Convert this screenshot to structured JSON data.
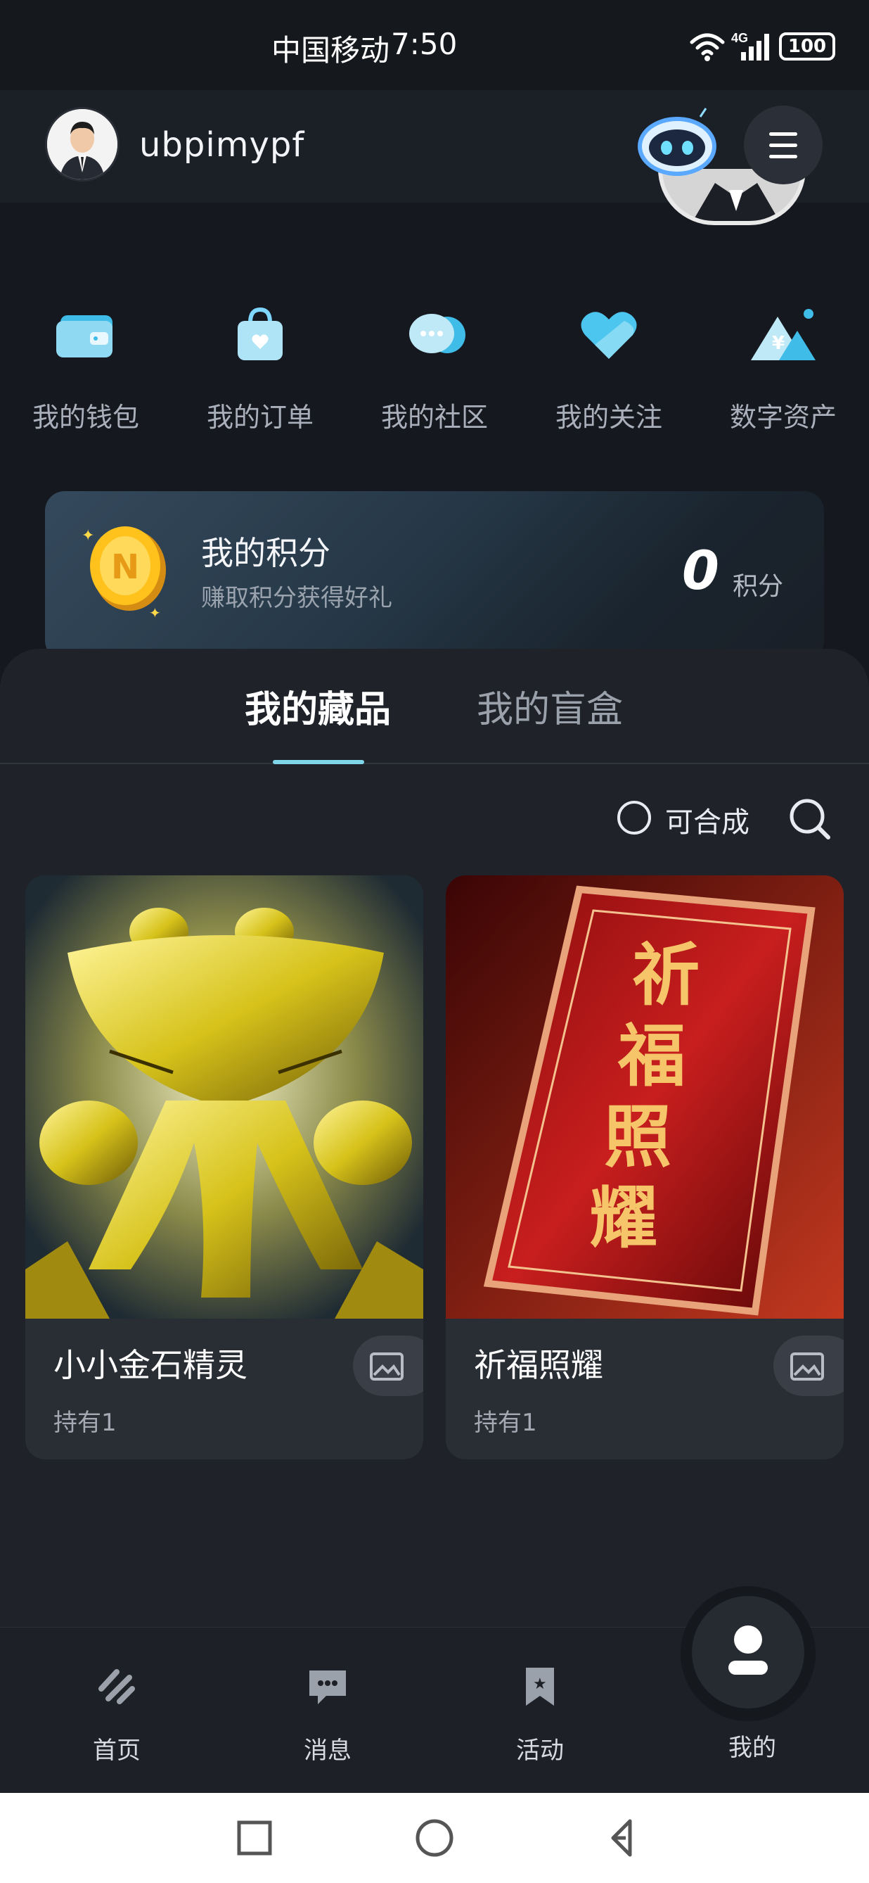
{
  "status_bar": {
    "carrier": "中国移动",
    "time": "7:50",
    "network": "4G",
    "battery": "100"
  },
  "header": {
    "username": "ubpimypf"
  },
  "quick_nav": [
    {
      "label": "我的钱包",
      "icon": "wallet-icon"
    },
    {
      "label": "我的订单",
      "icon": "order-bag-icon"
    },
    {
      "label": "我的社区",
      "icon": "community-chat-icon"
    },
    {
      "label": "我的关注",
      "icon": "heart-icon"
    },
    {
      "label": "数字资产",
      "icon": "digital-asset-icon"
    }
  ],
  "points": {
    "title": "我的积分",
    "subtitle": "赚取积分获得好礼",
    "value": "0",
    "unit": "积分"
  },
  "tabs": {
    "collection": "我的藏品",
    "blindbox": "我的盲盒"
  },
  "filter": {
    "combine_label": "可合成"
  },
  "items": [
    {
      "title": "小小金石精灵",
      "hold": "持有1",
      "image_text": ""
    },
    {
      "title": "祈福照耀",
      "hold": "持有1",
      "image_text": "祈福照耀"
    }
  ],
  "bottom_nav": [
    {
      "label": "首页",
      "icon": "home-icon"
    },
    {
      "label": "消息",
      "icon": "message-icon"
    },
    {
      "label": "活动",
      "icon": "activity-bookmark-icon"
    },
    {
      "label": "我的",
      "icon": "profile-icon"
    }
  ],
  "colors": {
    "accent": "#7fd6e8",
    "background": "#15181e",
    "panel": "#1f2329"
  }
}
